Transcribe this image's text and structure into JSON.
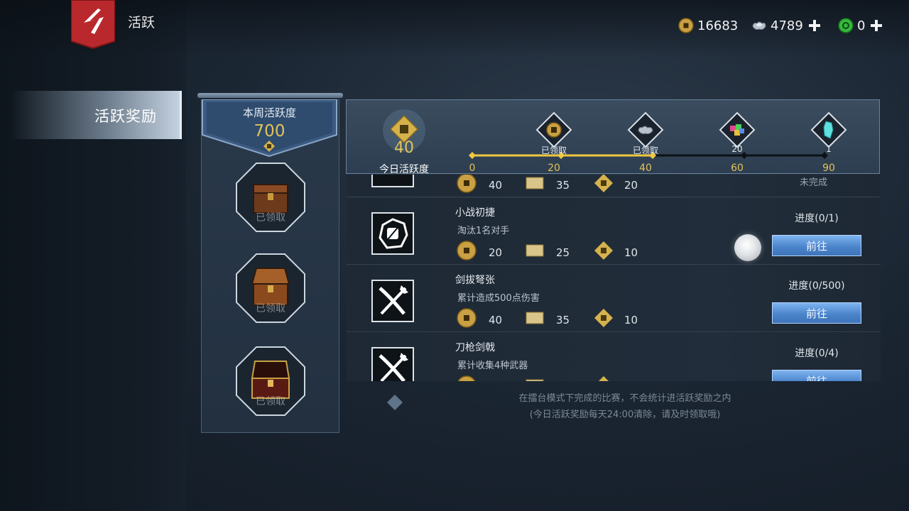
{
  "header": {
    "title": "活跃"
  },
  "currencies": [
    {
      "icon": "copper-coin-icon",
      "value": "16683"
    },
    {
      "icon": "silver-ingot-icon",
      "value": "4789"
    },
    {
      "icon": "jade-coin-icon",
      "value": "0"
    }
  ],
  "sidebar": {
    "tab_label": "活跃奖励"
  },
  "weekly": {
    "label": "本周活跃度",
    "value": "700",
    "chests": [
      {
        "icon": "chest-icon",
        "status": "已领取"
      },
      {
        "icon": "chest-icon",
        "status": "已领取"
      },
      {
        "icon": "chest-icon",
        "status": "已领取"
      }
    ]
  },
  "today": {
    "value": "40",
    "label": "今日活跃度",
    "progress_value": 40,
    "progress_max": 90,
    "ticks": [
      "0",
      "20",
      "40",
      "60",
      "90"
    ],
    "milestones": [
      {
        "icon": "copper-coin-icon",
        "status": "已领取"
      },
      {
        "icon": "silver-ingot-icon",
        "status": "已领取"
      },
      {
        "icon": "colorful-gems-icon",
        "status": "20"
      },
      {
        "icon": "jade-crystal-icon",
        "status": "1"
      }
    ]
  },
  "tasks": [
    {
      "name": "",
      "desc": "",
      "icon": "task-icon",
      "rewards": {
        "coin": "40",
        "ticket": "35",
        "activity": "20"
      },
      "progress": "",
      "status": "未完成",
      "button": ""
    },
    {
      "name": "小战初捷",
      "desc": "淘汰1名对手",
      "icon": "fist-icon",
      "rewards": {
        "coin": "20",
        "ticket": "25",
        "activity": "10"
      },
      "progress": "进度(0/1)",
      "button": "前往"
    },
    {
      "name": "剑拔弩张",
      "desc": "累计造成500点伤害",
      "icon": "crossed-weapons-icon",
      "rewards": {
        "coin": "40",
        "ticket": "35",
        "activity": "10"
      },
      "progress": "进度(0/500)",
      "button": "前往"
    },
    {
      "name": "刀枪剑戟",
      "desc": "累计收集4种武器",
      "icon": "crossed-weapons-icon",
      "rewards": {
        "coin": "",
        "ticket": "",
        "activity": ""
      },
      "progress": "进度(0/4)",
      "button": "前往"
    }
  ],
  "notes": {
    "line1": "在擂台模式下完成的比赛，不会统计进活跃奖励之内",
    "line2": "(今日活跃奖励每天24:00清除，请及时领取哦)"
  },
  "colors": {
    "accent_gold": "#e2c35a",
    "button_blue": "#4b85cc",
    "back_red": "#b8282c"
  }
}
